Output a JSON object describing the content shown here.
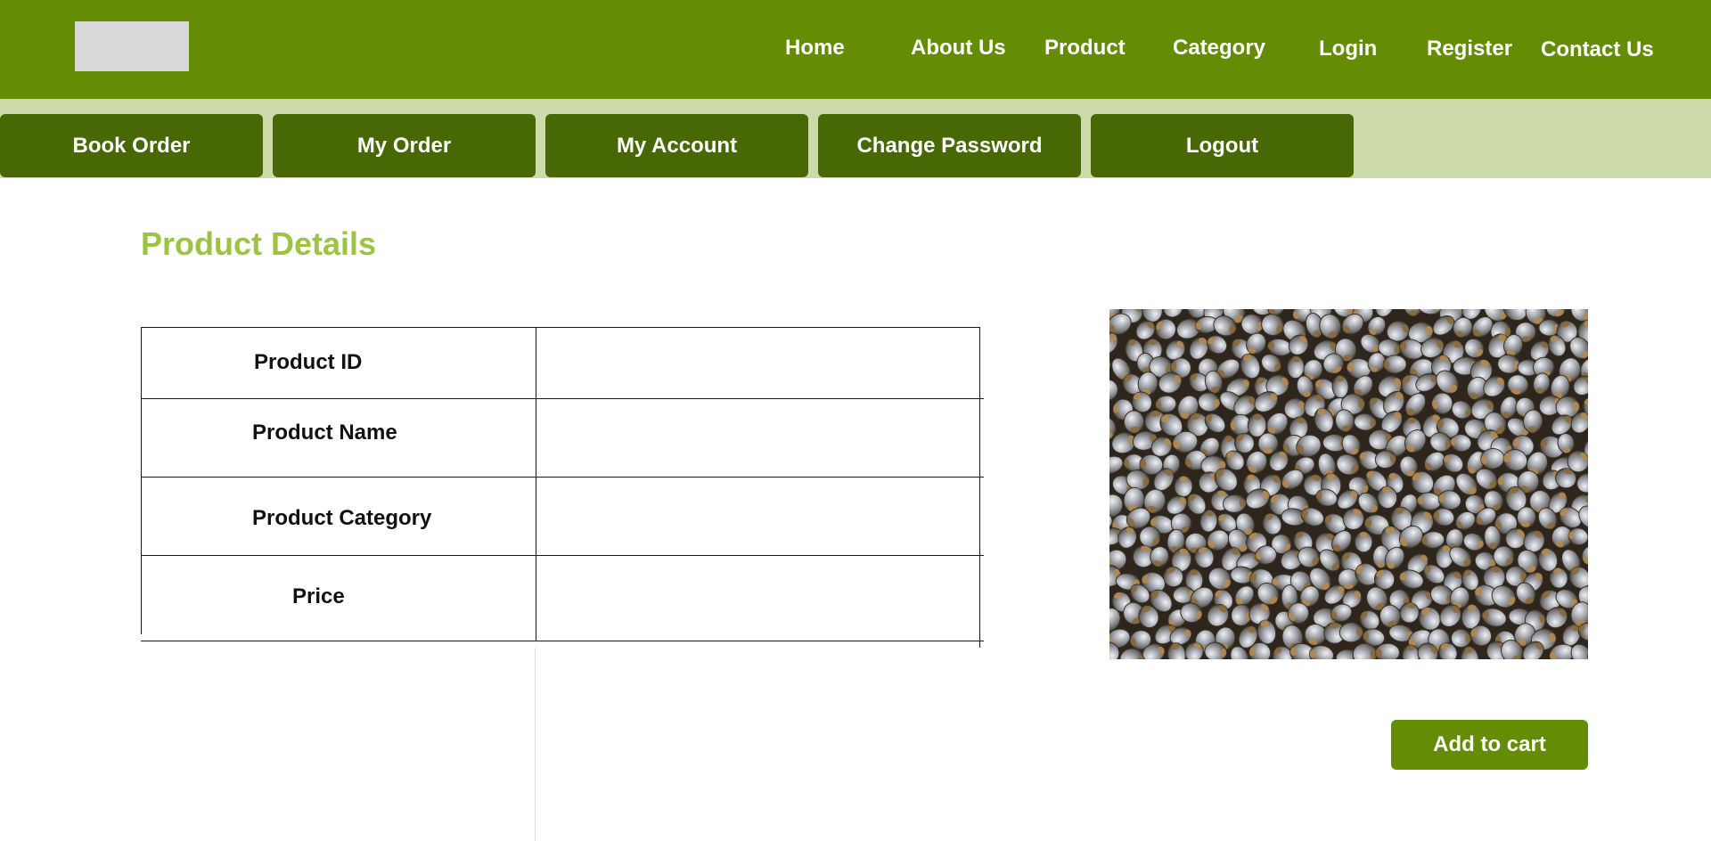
{
  "nav": {
    "links": [
      {
        "label": "Home"
      },
      {
        "label": "About Us"
      },
      {
        "label": "Product"
      },
      {
        "label": "Category"
      },
      {
        "label": "Login"
      },
      {
        "label": "Register"
      },
      {
        "label": "Contact Us"
      }
    ]
  },
  "subnav": {
    "buttons": [
      {
        "label": "Book Order"
      },
      {
        "label": "My Order"
      },
      {
        "label": "My Account"
      },
      {
        "label": "Change Password"
      },
      {
        "label": "Logout"
      }
    ]
  },
  "main": {
    "title": "Product Details",
    "details": [
      {
        "label": "Product ID",
        "value": ""
      },
      {
        "label": "Product Name",
        "value": ""
      },
      {
        "label": "Product Category",
        "value": ""
      },
      {
        "label": "Price",
        "value": ""
      }
    ],
    "image_subject": "millet grains",
    "add_to_cart_label": "Add to cart"
  },
  "colors": {
    "header_bg": "#658c05",
    "subbar_bg": "#cddbab",
    "subnav_button_bg": "#476805",
    "title": "#9cc442",
    "cart_button_bg": "#658c05"
  }
}
